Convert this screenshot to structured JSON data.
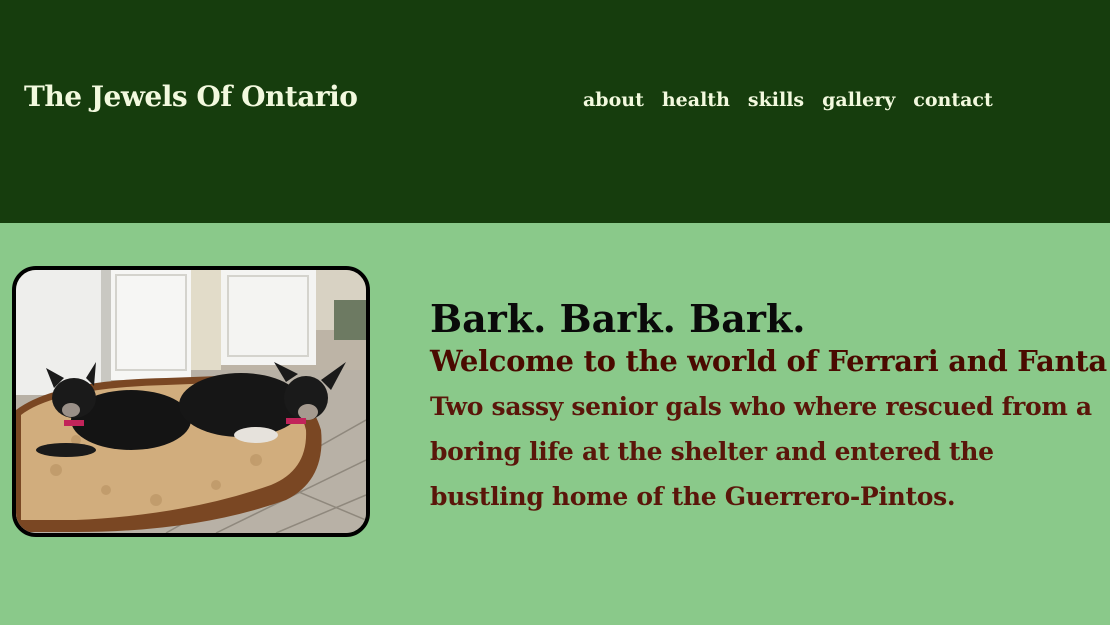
{
  "header": {
    "site_title": "The Jewels Of Ontario",
    "nav": [
      "about",
      "health",
      "skills",
      "gallery",
      "contact"
    ]
  },
  "hero": {
    "photo_alt": "Two small black senior dogs lying on a dog bed",
    "heading": "Bark. Bark. Bark.",
    "subheading": "Welcome to the world of Ferrari and Fanta!",
    "body": "Two sassy senior gals who where rescued from a boring life at the shelter and entered the bustling home of the Guerrero-Pintos."
  },
  "colors": {
    "header_bg": "#163d0d",
    "page_bg": "#8ac98a",
    "nav_text": "#f2f9de",
    "heading": "#0a0a0a",
    "subheading": "#4a0a00",
    "body_text": "#5a160a"
  }
}
